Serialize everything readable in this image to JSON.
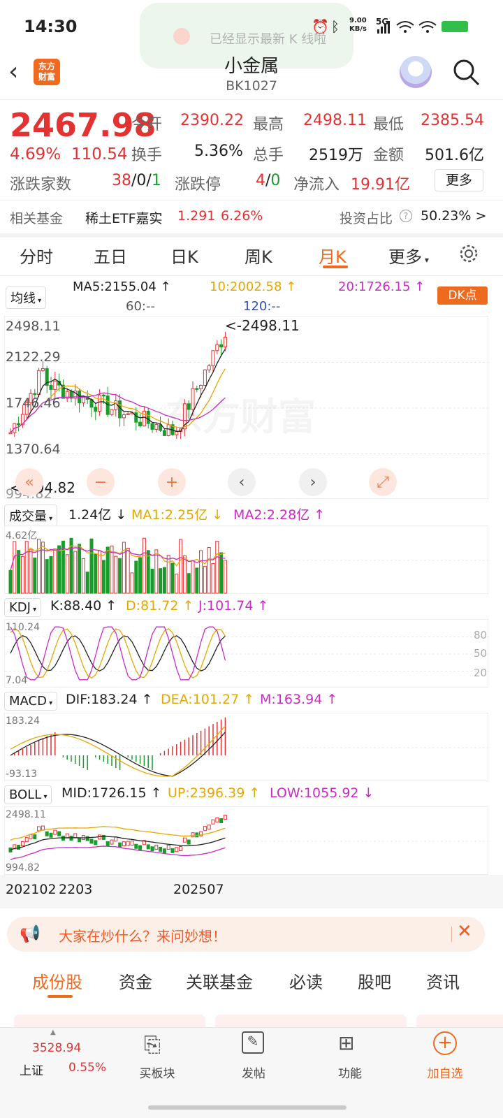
{
  "status": {
    "time": "14:30",
    "net_speed": "9.00\nKB/s",
    "network": "5G"
  },
  "toast": {
    "text": "已经显示最新 K 线啦"
  },
  "header": {
    "logo_text": "东方\n财富",
    "title": "小金属",
    "code": "BK1027"
  },
  "quote": {
    "price": "2467.98",
    "change_pct": "4.69%",
    "change": "110.54",
    "open_label": "今开",
    "open": "2390.22",
    "high_label": "最高",
    "high": "2498.11",
    "low_label": "最低",
    "low": "2385.54",
    "turnover_label": "换手",
    "turnover": "5.36%",
    "volume_label": "总手",
    "volume": "2519万",
    "amount_label": "金额",
    "amount": "501.6亿",
    "breadth_label": "涨跌家数",
    "breadth_up": "38",
    "breadth_flat": "0",
    "breadth_down": "1",
    "limit_label": "涨跌停",
    "limit_up": "4",
    "limit_down": "0",
    "netflow_label": "净流入",
    "netflow": "19.91亿",
    "more_button": "更多"
  },
  "fund": {
    "label": "相关基金",
    "name": "稀土ETF嘉实",
    "price": "1.291",
    "pct": "6.26%",
    "ratio_label": "投资占比",
    "ratio": "50.23% >"
  },
  "tabs": [
    "分时",
    "五日",
    "日K",
    "周K",
    "月K",
    "更多"
  ],
  "active_tab": "月K",
  "main_chart": {
    "indicator": "均线",
    "ma5": "MA5:2155.04 ↑",
    "ma10": "10:2002.58 ↑",
    "ma20": "20:1726.15 ↑",
    "ma60": "60:--",
    "ma120": "120:--",
    "dk_button": "DK点",
    "axis_top": "2498.11",
    "axis_2": "2122.29",
    "axis_3": "1746.46",
    "axis_4": "1370.64",
    "axis_bottom": "994.82",
    "high_marker": "<-2498.11",
    "low_marker": "<-994.82"
  },
  "volume_panel": {
    "label": "成交量",
    "value": "1.24亿 ↓",
    "ma1": "MA1:2.25亿 ↓",
    "ma2": "MA2:2.28亿 ↑",
    "axis_top": "4.62亿"
  },
  "kdj_panel": {
    "label": "KDJ",
    "k": "K:88.40 ↑",
    "d": "D:81.72 ↑",
    "j": "J:101.74 ↑",
    "axis_top": "110.24",
    "axis_bottom": "7.04",
    "levels": [
      "80",
      "50",
      "20"
    ]
  },
  "macd_panel": {
    "label": "MACD",
    "dif": "DIF:183.24 ↑",
    "dea": "DEA:101.27 ↑",
    "m": "M:163.94 ↑",
    "axis_top": "183.24",
    "axis_bottom": "-93.13"
  },
  "boll_panel": {
    "label": "BOLL",
    "mid": "MID:1726.15 ↑",
    "up": "UP:2396.39 ↑",
    "low": "LOW:1055.92 ↓",
    "axis_top": "2498.11",
    "axis_bottom": "994.82"
  },
  "x_axis": {
    "start": "202102",
    "mid": "2203",
    "end": "202507"
  },
  "banner": {
    "text": "大家在炒什么？来问妙想！"
  },
  "bottom_tabs": [
    "成份股",
    "资金",
    "关联基金",
    "必读",
    "股吧",
    "资讯"
  ],
  "bottom_nav": {
    "index_value": "3528.94",
    "index_name": "上证",
    "index_pct": "0.55%",
    "items": [
      "买板块",
      "发帖",
      "功能",
      "加自选"
    ]
  },
  "colors": {
    "up": "#e33232",
    "down": "#1a9b2c",
    "accent": "#ee6a1f"
  }
}
